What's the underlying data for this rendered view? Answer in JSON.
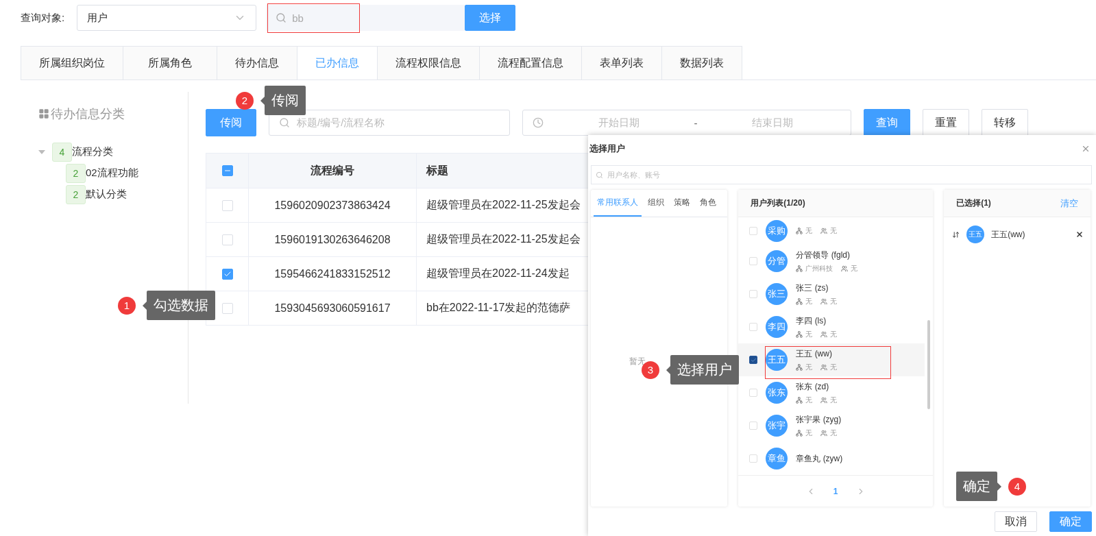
{
  "query": {
    "label": "查询对象:",
    "object_select": "用户",
    "search_value": "bb",
    "select_button": "选择"
  },
  "tabs": [
    {
      "label": "所属组织岗位",
      "selected": false
    },
    {
      "label": "所属角色",
      "selected": false
    },
    {
      "label": "待办信息",
      "selected": false
    },
    {
      "label": "已办信息",
      "selected": true
    },
    {
      "label": "流程权限信息",
      "selected": false
    },
    {
      "label": "流程配置信息",
      "selected": false
    },
    {
      "label": "表单列表",
      "selected": false
    },
    {
      "label": "数据列表",
      "selected": false
    }
  ],
  "sidebar": {
    "title": "待办信息分类",
    "tree": [
      {
        "label": "流程分类",
        "count": "4",
        "expanded": true,
        "children": [
          {
            "label": "02流程功能",
            "count": "2"
          },
          {
            "label": "默认分类",
            "count": "2"
          }
        ]
      }
    ]
  },
  "toolbar": {
    "circulate_button": "传阅",
    "search_placeholder": "标题/编号/流程名称",
    "start_placeholder": "开始日期",
    "range_separator": "-",
    "end_placeholder": "结束日期",
    "buttons": [
      {
        "label": "查询",
        "kind": "primary"
      },
      {
        "label": "重置",
        "kind": "default"
      },
      {
        "label": "转移",
        "kind": "default"
      }
    ]
  },
  "table": {
    "header_indeterminate": true,
    "columns": [
      "流程编号",
      "标题"
    ],
    "rows": [
      {
        "checked": false,
        "cells": [
          "1596020902373863424",
          "超级管理员在2022-11-25发起会"
        ]
      },
      {
        "checked": false,
        "cells": [
          "1596019130263646208",
          "超级管理员在2022-11-25发起会"
        ]
      },
      {
        "checked": true,
        "cells": [
          "1595466241833152512",
          "超级管理员在2022-11-24发起"
        ]
      },
      {
        "checked": false,
        "cells": [
          "1593045693060591617",
          "bb在2022-11-17发起的范德萨"
        ]
      }
    ]
  },
  "dialog": {
    "title": "选择用户",
    "search_placeholder": "用户名称、账号",
    "source_tabs": [
      {
        "label": "常用联系人",
        "selected": true
      },
      {
        "label": "组织",
        "selected": false
      },
      {
        "label": "策略",
        "selected": false
      },
      {
        "label": "角色",
        "selected": false
      }
    ],
    "empty_text": "暂无",
    "user_list": {
      "title": "用户列表(1/20)",
      "users": [
        {
          "avatar": "采购",
          "org": "无",
          "role": "无",
          "checked": false
        },
        {
          "avatar": "分管",
          "name": "分管领导",
          "account": "(fgld)",
          "org": "广州科技",
          "role": "无",
          "checked": false
        },
        {
          "avatar": "张三",
          "name": "张三",
          "account": "(zs)",
          "org": "无",
          "role": "无",
          "checked": false
        },
        {
          "avatar": "李四",
          "name": "李四",
          "account": "(ls)",
          "org": "无",
          "role": "无",
          "checked": false
        },
        {
          "avatar": "王五",
          "name": "王五",
          "account": "(ww)",
          "org": "无",
          "role": "无",
          "checked": true
        },
        {
          "avatar": "张东",
          "name": "张东",
          "account": "(zd)",
          "org": "无",
          "role": "无",
          "checked": false
        },
        {
          "avatar": "张宇",
          "name": "张宇果",
          "account": "(zyg)",
          "org": "无",
          "role": "无",
          "checked": false
        },
        {
          "avatar": "章鱼",
          "name": "章鱼丸",
          "account": "(zyw)",
          "checked": false
        }
      ],
      "page": "1"
    },
    "selected_panel": {
      "title": "已选择(1)",
      "clear": "清空",
      "items": [
        {
          "avatar": "王五",
          "label": "王五(ww)"
        }
      ]
    },
    "cancel_button": "取消",
    "ok_button": "确定"
  },
  "annotations": [
    {
      "number": "2",
      "text": "传阅"
    },
    {
      "number": "1",
      "text": "勾选数据"
    },
    {
      "number": "3",
      "text": "选择用户"
    },
    {
      "number": "4",
      "text": "确定"
    }
  ]
}
